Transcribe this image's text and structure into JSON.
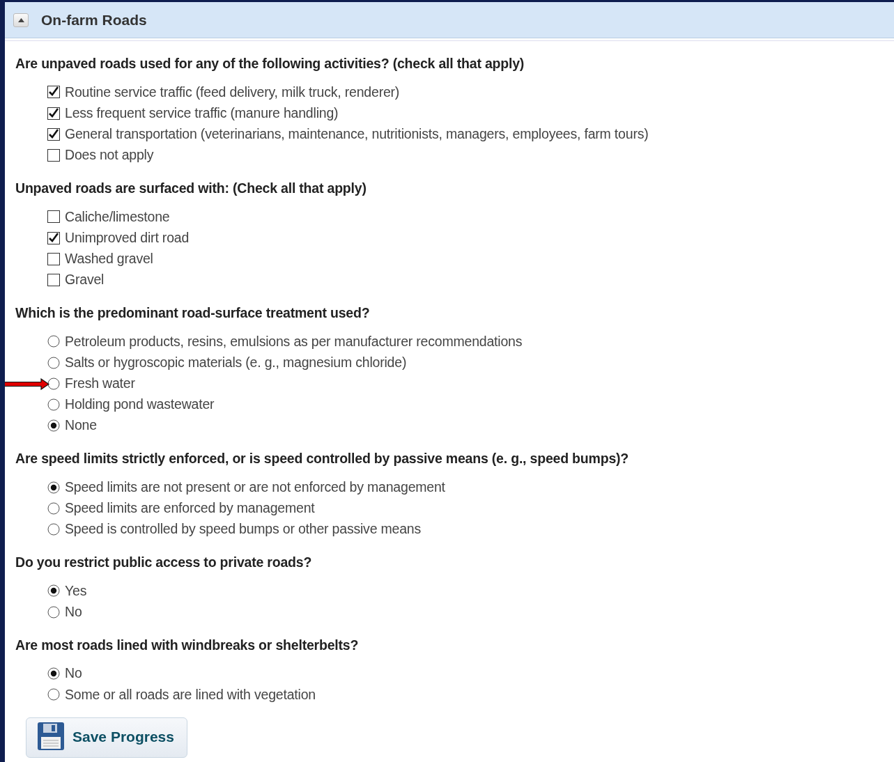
{
  "section": {
    "title": "On-farm Roads",
    "expanded": true
  },
  "questions": [
    {
      "text": "Are unpaved roads used for any of the following activities? (check all that apply)",
      "kind": "checkbox",
      "options": [
        {
          "label": "Routine service traffic (feed delivery, milk truck, renderer)",
          "selected": true
        },
        {
          "label": "Less frequent service traffic (manure handling)",
          "selected": true
        },
        {
          "label": "General transportation (veterinarians, maintenance, nutritionists, managers, employees, farm tours)",
          "selected": true
        },
        {
          "label": "Does not apply",
          "selected": false
        }
      ]
    },
    {
      "text": "Unpaved roads are surfaced with: (Check all that apply)",
      "kind": "checkbox",
      "options": [
        {
          "label": "Caliche/limestone",
          "selected": false
        },
        {
          "label": "Unimproved dirt road",
          "selected": true
        },
        {
          "label": "Washed gravel",
          "selected": false
        },
        {
          "label": "Gravel",
          "selected": false
        }
      ]
    },
    {
      "text": "Which is the predominant road-surface treatment used?",
      "kind": "radio",
      "options": [
        {
          "label": "Petroleum products, resins, emulsions as per manufacturer recommendations",
          "selected": false
        },
        {
          "label": "Salts or hygroscopic materials (e. g., magnesium chloride)",
          "selected": false
        },
        {
          "label": "Fresh water",
          "selected": false,
          "arrow": true
        },
        {
          "label": "Holding pond wastewater",
          "selected": false
        },
        {
          "label": "None",
          "selected": true
        }
      ]
    },
    {
      "text": "Are speed limits strictly enforced, or is speed controlled by passive means (e. g., speed bumps)?",
      "kind": "radio",
      "options": [
        {
          "label": "Speed limits are not present or are not enforced by management",
          "selected": true
        },
        {
          "label": "Speed limits are enforced by management",
          "selected": false
        },
        {
          "label": "Speed is controlled by speed bumps or other passive means",
          "selected": false
        }
      ]
    },
    {
      "text": "Do you restrict public access to private roads?",
      "kind": "radio",
      "options": [
        {
          "label": "Yes",
          "selected": true
        },
        {
          "label": "No",
          "selected": false
        }
      ]
    },
    {
      "text": "Are most roads lined with windbreaks or shelterbelts?",
      "kind": "radio",
      "options": [
        {
          "label": "No",
          "selected": true
        },
        {
          "label": "Some or all roads are lined with vegetation",
          "selected": false
        }
      ]
    }
  ],
  "save_button": {
    "label": "Save Progress"
  }
}
